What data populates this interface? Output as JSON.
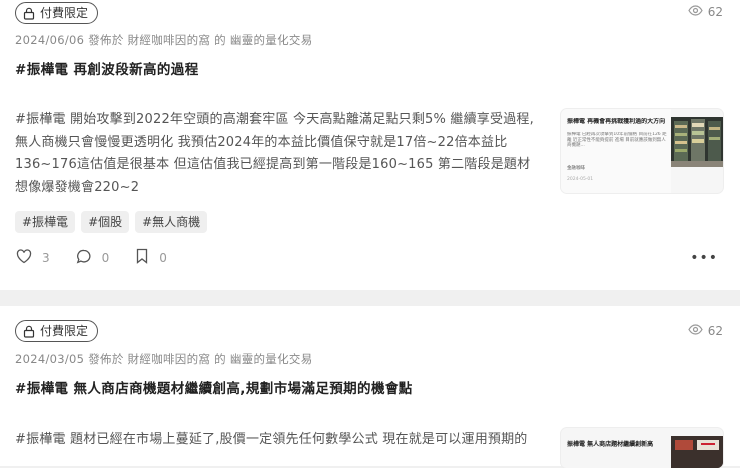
{
  "posts": [
    {
      "badge_label": "付費限定",
      "views": "62",
      "meta": "2024/06/06 發佈於 財經咖啡因的窩 的 幽靈的量化交易",
      "title": "#振樺電 再創波段新高的過程",
      "body_lines": [
        "#振樺電 開始攻擊到2022年空頭的高潮套牢區 今天高點離滿足點只剩5% 繼續享受過程,",
        "無人商機只會慢慢更透明化 我預估2024年的本益比價值保守就是17倍~22倍本益比",
        "136~176這估值是很基本 但這估值我已經提高到第一階段是160~165 第二階段是題材",
        "想像爆發機會220~2"
      ],
      "tags": [
        "#振樺電",
        "#個股",
        "#無人商機"
      ],
      "likes": "3",
      "comments": "0",
      "saves": "0",
      "thumb": {
        "headline": "振樺電 再機會再挑戰獲利過的大方向",
        "caption": "振樺電 已經再次攻擊到10年前價格 目前在126 距離 近正常性不能夠提前 進場 目前就應該做到無人商機題...",
        "author": "金融咖啡",
        "date": "2024-05-01"
      }
    },
    {
      "badge_label": "付費限定",
      "views": "62",
      "meta": "2024/03/05 發佈於 財經咖啡因的窩 的 幽靈的量化交易",
      "title": "#振樺電 無人商店商機題材繼續創高,規劃市場滿足預期的機會點",
      "body_lines": [
        "#振樺電 題材已經在市場上蔓延了,股價一定領先任何數學公式 現在就是可以運用預期的"
      ],
      "thumb": {
        "headline": "振樺電 無人商店題材繼續創新高"
      }
    }
  ]
}
